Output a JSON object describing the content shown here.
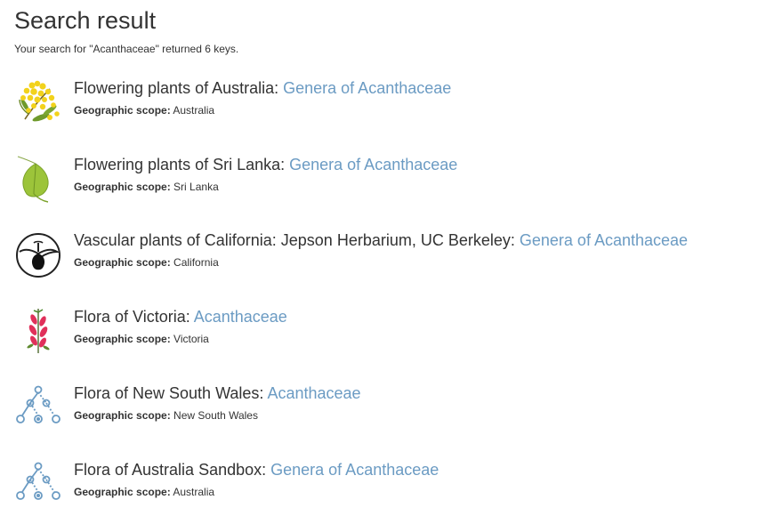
{
  "heading": "Search result",
  "summary": "Your search for \"Acanthaceae\" returned 6 keys.",
  "results": [
    {
      "project": "Flowering plants of Australia: ",
      "key": "Genera of Acanthaceae",
      "scope_label": "Geographic scope:",
      "scope": "Australia",
      "icon": "wattle-flower-icon"
    },
    {
      "project": "Flowering plants of Sri Lanka: ",
      "key": "Genera of Acanthaceae",
      "scope_label": "Geographic scope:",
      "scope": "Sri Lanka",
      "icon": "green-leaf-icon"
    },
    {
      "project": "Vascular plants of California: Jepson Herbarium, UC Berkeley: ",
      "key": "Genera of Acanthaceae",
      "scope_label": "Geographic scope:",
      "scope": "California",
      "icon": "jepson-logo-icon"
    },
    {
      "project": "Flora of Victoria: ",
      "key": "Acanthaceae",
      "scope_label": "Geographic scope:",
      "scope": "Victoria",
      "icon": "pink-flower-icon"
    },
    {
      "project": "Flora of New South Wales: ",
      "key": "Acanthaceae",
      "scope_label": "Geographic scope:",
      "scope": "New South Wales",
      "icon": "key-tree-icon"
    },
    {
      "project": "Flora of Australia Sandbox: ",
      "key": "Genera of Acanthaceae",
      "scope_label": "Geographic scope:",
      "scope": "Australia",
      "icon": "key-tree-icon"
    }
  ],
  "colors": {
    "link": "#6b9bc3",
    "text": "#333333"
  }
}
